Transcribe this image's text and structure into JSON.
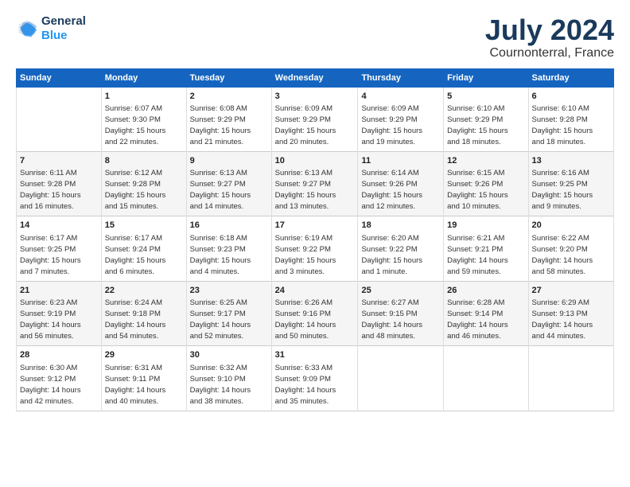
{
  "header": {
    "logo_line1": "General",
    "logo_line2": "Blue",
    "title": "July 2024",
    "subtitle": "Cournonterral, France"
  },
  "days": [
    "Sunday",
    "Monday",
    "Tuesday",
    "Wednesday",
    "Thursday",
    "Friday",
    "Saturday"
  ],
  "weeks": [
    [
      {
        "date": "",
        "text": ""
      },
      {
        "date": "1",
        "text": "Sunrise: 6:07 AM\nSunset: 9:30 PM\nDaylight: 15 hours\nand 22 minutes."
      },
      {
        "date": "2",
        "text": "Sunrise: 6:08 AM\nSunset: 9:29 PM\nDaylight: 15 hours\nand 21 minutes."
      },
      {
        "date": "3",
        "text": "Sunrise: 6:09 AM\nSunset: 9:29 PM\nDaylight: 15 hours\nand 20 minutes."
      },
      {
        "date": "4",
        "text": "Sunrise: 6:09 AM\nSunset: 9:29 PM\nDaylight: 15 hours\nand 19 minutes."
      },
      {
        "date": "5",
        "text": "Sunrise: 6:10 AM\nSunset: 9:29 PM\nDaylight: 15 hours\nand 18 minutes."
      },
      {
        "date": "6",
        "text": "Sunrise: 6:10 AM\nSunset: 9:28 PM\nDaylight: 15 hours\nand 18 minutes."
      }
    ],
    [
      {
        "date": "7",
        "text": "Sunrise: 6:11 AM\nSunset: 9:28 PM\nDaylight: 15 hours\nand 16 minutes."
      },
      {
        "date": "8",
        "text": "Sunrise: 6:12 AM\nSunset: 9:28 PM\nDaylight: 15 hours\nand 15 minutes."
      },
      {
        "date": "9",
        "text": "Sunrise: 6:13 AM\nSunset: 9:27 PM\nDaylight: 15 hours\nand 14 minutes."
      },
      {
        "date": "10",
        "text": "Sunrise: 6:13 AM\nSunset: 9:27 PM\nDaylight: 15 hours\nand 13 minutes."
      },
      {
        "date": "11",
        "text": "Sunrise: 6:14 AM\nSunset: 9:26 PM\nDaylight: 15 hours\nand 12 minutes."
      },
      {
        "date": "12",
        "text": "Sunrise: 6:15 AM\nSunset: 9:26 PM\nDaylight: 15 hours\nand 10 minutes."
      },
      {
        "date": "13",
        "text": "Sunrise: 6:16 AM\nSunset: 9:25 PM\nDaylight: 15 hours\nand 9 minutes."
      }
    ],
    [
      {
        "date": "14",
        "text": "Sunrise: 6:17 AM\nSunset: 9:25 PM\nDaylight: 15 hours\nand 7 minutes."
      },
      {
        "date": "15",
        "text": "Sunrise: 6:17 AM\nSunset: 9:24 PM\nDaylight: 15 hours\nand 6 minutes."
      },
      {
        "date": "16",
        "text": "Sunrise: 6:18 AM\nSunset: 9:23 PM\nDaylight: 15 hours\nand 4 minutes."
      },
      {
        "date": "17",
        "text": "Sunrise: 6:19 AM\nSunset: 9:22 PM\nDaylight: 15 hours\nand 3 minutes."
      },
      {
        "date": "18",
        "text": "Sunrise: 6:20 AM\nSunset: 9:22 PM\nDaylight: 15 hours\nand 1 minute."
      },
      {
        "date": "19",
        "text": "Sunrise: 6:21 AM\nSunset: 9:21 PM\nDaylight: 14 hours\nand 59 minutes."
      },
      {
        "date": "20",
        "text": "Sunrise: 6:22 AM\nSunset: 9:20 PM\nDaylight: 14 hours\nand 58 minutes."
      }
    ],
    [
      {
        "date": "21",
        "text": "Sunrise: 6:23 AM\nSunset: 9:19 PM\nDaylight: 14 hours\nand 56 minutes."
      },
      {
        "date": "22",
        "text": "Sunrise: 6:24 AM\nSunset: 9:18 PM\nDaylight: 14 hours\nand 54 minutes."
      },
      {
        "date": "23",
        "text": "Sunrise: 6:25 AM\nSunset: 9:17 PM\nDaylight: 14 hours\nand 52 minutes."
      },
      {
        "date": "24",
        "text": "Sunrise: 6:26 AM\nSunset: 9:16 PM\nDaylight: 14 hours\nand 50 minutes."
      },
      {
        "date": "25",
        "text": "Sunrise: 6:27 AM\nSunset: 9:15 PM\nDaylight: 14 hours\nand 48 minutes."
      },
      {
        "date": "26",
        "text": "Sunrise: 6:28 AM\nSunset: 9:14 PM\nDaylight: 14 hours\nand 46 minutes."
      },
      {
        "date": "27",
        "text": "Sunrise: 6:29 AM\nSunset: 9:13 PM\nDaylight: 14 hours\nand 44 minutes."
      }
    ],
    [
      {
        "date": "28",
        "text": "Sunrise: 6:30 AM\nSunset: 9:12 PM\nDaylight: 14 hours\nand 42 minutes."
      },
      {
        "date": "29",
        "text": "Sunrise: 6:31 AM\nSunset: 9:11 PM\nDaylight: 14 hours\nand 40 minutes."
      },
      {
        "date": "30",
        "text": "Sunrise: 6:32 AM\nSunset: 9:10 PM\nDaylight: 14 hours\nand 38 minutes."
      },
      {
        "date": "31",
        "text": "Sunrise: 6:33 AM\nSunset: 9:09 PM\nDaylight: 14 hours\nand 35 minutes."
      },
      {
        "date": "",
        "text": ""
      },
      {
        "date": "",
        "text": ""
      },
      {
        "date": "",
        "text": ""
      }
    ]
  ]
}
